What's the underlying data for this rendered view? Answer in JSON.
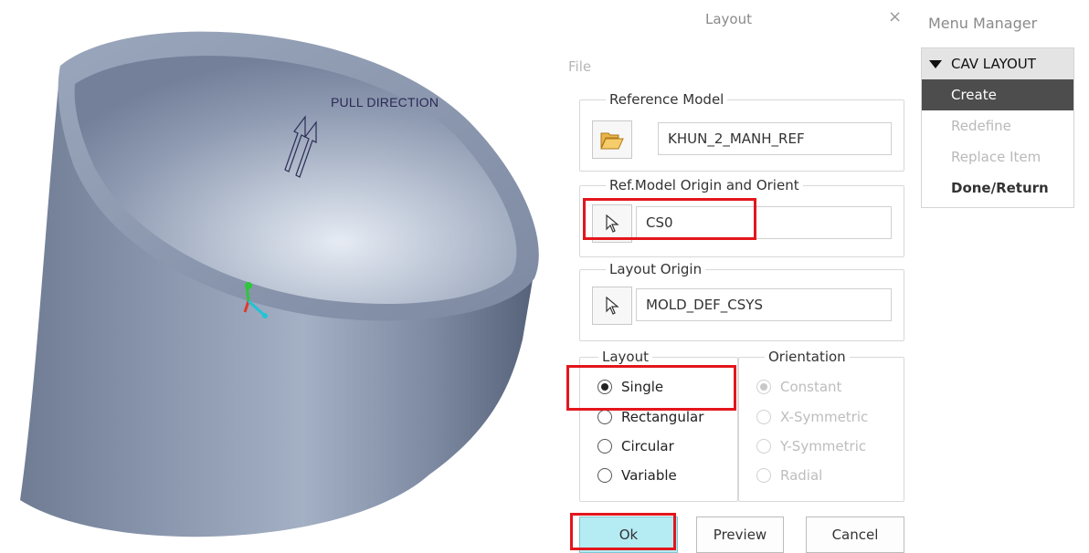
{
  "viewport": {
    "pull_direction_label": "PULL DIRECTION"
  },
  "dialog": {
    "title": "Layout",
    "close_glyph": "×",
    "menu_file": "File",
    "reference_model": {
      "legend": "Reference Model",
      "value": "KHUN_2_MANH_REF",
      "icon": "folder-open-icon"
    },
    "ref_origin": {
      "legend": "Ref.Model Origin and Orient",
      "value": "CS0",
      "icon": "cursor-select-icon"
    },
    "layout_origin": {
      "legend": "Layout Origin",
      "value": "MOLD_DEF_CSYS",
      "icon": "cursor-select-icon"
    },
    "layout_group": {
      "legend": "Layout",
      "options": [
        {
          "label": "Single",
          "selected": true
        },
        {
          "label": "Rectangular",
          "selected": false
        },
        {
          "label": "Circular",
          "selected": false
        },
        {
          "label": "Variable",
          "selected": false
        }
      ]
    },
    "orientation_group": {
      "legend": "Orientation",
      "options": [
        {
          "label": "Constant",
          "selected": true,
          "disabled": true
        },
        {
          "label": "X-Symmetric",
          "selected": false,
          "disabled": true
        },
        {
          "label": "Y-Symmetric",
          "selected": false,
          "disabled": true
        },
        {
          "label": "Radial",
          "selected": false,
          "disabled": true
        }
      ]
    },
    "buttons": {
      "ok": "Ok",
      "preview": "Preview",
      "cancel": "Cancel"
    }
  },
  "menu_manager": {
    "title": "Menu Manager",
    "section": "CAV LAYOUT",
    "items": [
      {
        "label": "Create",
        "state": "selected"
      },
      {
        "label": "Redefine",
        "state": "disabled"
      },
      {
        "label": "Replace Item",
        "state": "disabled"
      },
      {
        "label": "Done/Return",
        "state": "bold"
      }
    ]
  },
  "colors": {
    "highlight": "#e3161c",
    "ok_button": "#b5ecf4",
    "model_body": "#8e9bb3"
  }
}
